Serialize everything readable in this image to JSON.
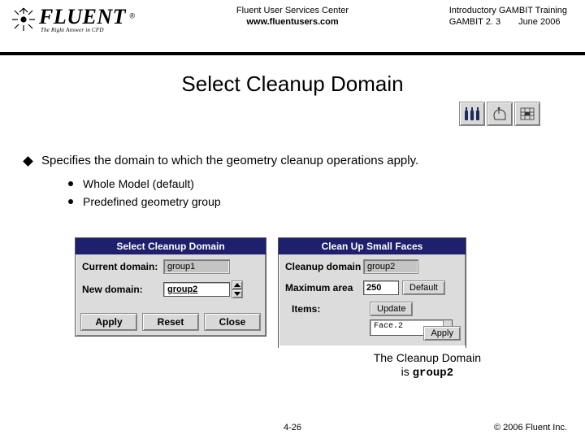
{
  "header": {
    "logo_text": "FLUENT",
    "logo_sub": "The Right Answer in CFD",
    "logo_reg": "®",
    "center_line1": "Fluent User Services Center",
    "center_line2": "www.fluentusers.com",
    "right_line1": "Introductory GAMBIT Training",
    "right_line2a": "GAMBIT 2. 3",
    "right_line2b": "June 2006"
  },
  "title": "Select Cleanup Domain",
  "iconrow": {
    "icon1": "bottles-icon",
    "icon2": "hand-point-icon",
    "icon3": "grid-select-icon"
  },
  "bullet_main": "Specifies the domain to which the geometry cleanup operations apply.",
  "bullet_sub": [
    "Whole Model (default)",
    "Predefined geometry group"
  ],
  "dialog_a": {
    "title": "Select Cleanup Domain",
    "row1_label": "Current domain:",
    "row1_value": "group1",
    "row2_label": "New domain:",
    "row2_value": "group2",
    "btn_apply": "Apply",
    "btn_reset": "Reset",
    "btn_close": "Close"
  },
  "dialog_b": {
    "title": "Clean Up Small Faces",
    "row1_label": "Cleanup domain",
    "row1_value": "group2",
    "row2_label": "Maximum area",
    "row2_value": "250",
    "row2_btn": "Default",
    "items_label": "Items:",
    "items_update": "Update",
    "list_value": "Face.2",
    "btn_apply": "Apply"
  },
  "callout_line1": "The Cleanup Domain",
  "callout_line2_pre": "is ",
  "callout_line2_val": "group2",
  "footer": {
    "page": "4-26",
    "copyright": "© 2006 Fluent Inc."
  }
}
